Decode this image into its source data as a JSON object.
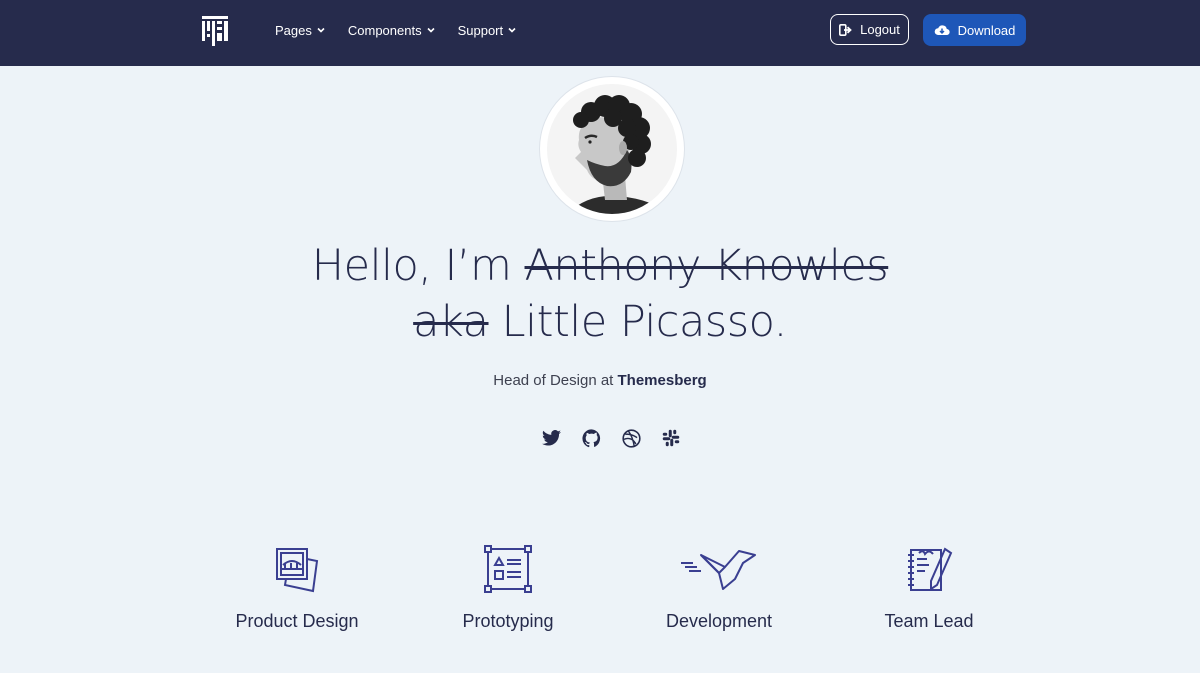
{
  "nav": {
    "logo": "logo-icon",
    "links": [
      {
        "label": "Pages"
      },
      {
        "label": "Components"
      },
      {
        "label": "Support"
      }
    ],
    "logout_label": "Logout",
    "download_label": "Download"
  },
  "hero": {
    "greeting": "Hello, I’m ",
    "struck_name": "Anthony Knowles",
    "struck_aka": "aka",
    "nickname": " Little Picasso.",
    "role": "Head of Design at ",
    "company": "Themesberg"
  },
  "socials": [
    "twitter-icon",
    "github-icon",
    "dribbble-icon",
    "slack-icon"
  ],
  "services": [
    {
      "label": "Product Design",
      "icon": "product-design-icon"
    },
    {
      "label": "Prototyping",
      "icon": "prototyping-icon"
    },
    {
      "label": "Development",
      "icon": "development-icon"
    },
    {
      "label": "Team Lead",
      "icon": "team-lead-icon"
    }
  ],
  "colors": {
    "navbar": "#262b4c",
    "background": "#edf3f8",
    "primary": "#1e57b8",
    "icon_accent": "#3a3f91"
  }
}
